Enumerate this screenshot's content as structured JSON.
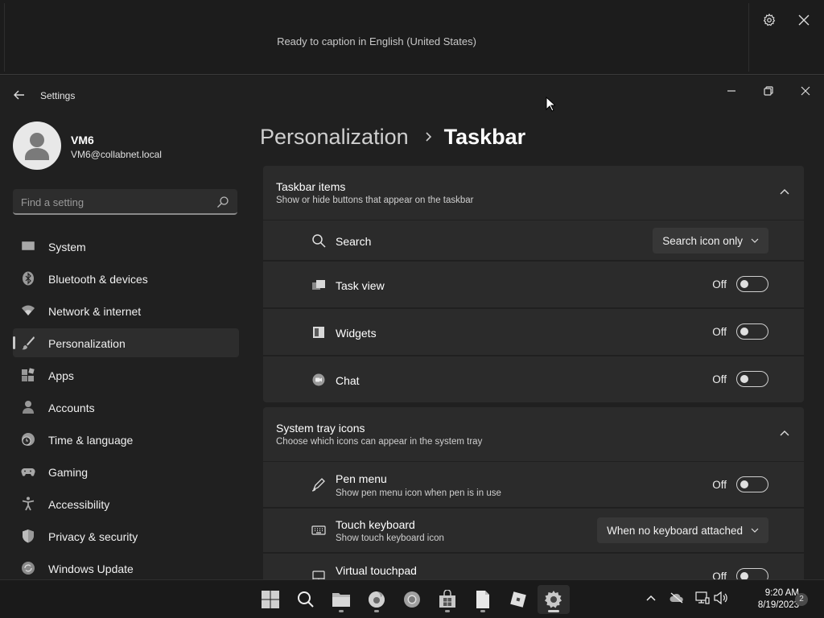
{
  "live_captions": {
    "status_text": "Ready to caption in English (United States)",
    "settings_icon": "gear-icon",
    "close_icon": "close-icon"
  },
  "window": {
    "app_title": "Settings",
    "back_icon": "back-arrow-icon",
    "minimize_icon": "minimize-icon",
    "restore_icon": "restore-icon",
    "close_icon": "close-icon"
  },
  "user": {
    "name": "VM6",
    "email": "VM6@collabnet.local"
  },
  "search": {
    "placeholder": "Find a setting",
    "value": ""
  },
  "sidebar": {
    "items": [
      {
        "label": "System",
        "icon": "monitor-icon",
        "active": false
      },
      {
        "label": "Bluetooth & devices",
        "icon": "bluetooth-icon",
        "active": false
      },
      {
        "label": "Network & internet",
        "icon": "wifi-icon",
        "active": false
      },
      {
        "label": "Personalization",
        "icon": "brush-icon",
        "active": true
      },
      {
        "label": "Apps",
        "icon": "apps-icon",
        "active": false
      },
      {
        "label": "Accounts",
        "icon": "person-icon",
        "active": false
      },
      {
        "label": "Time & language",
        "icon": "clock-globe-icon",
        "active": false
      },
      {
        "label": "Gaming",
        "icon": "gamepad-icon",
        "active": false
      },
      {
        "label": "Accessibility",
        "icon": "accessibility-icon",
        "active": false
      },
      {
        "label": "Privacy & security",
        "icon": "shield-icon",
        "active": false
      },
      {
        "label": "Windows Update",
        "icon": "update-icon",
        "active": false
      }
    ]
  },
  "breadcrumb": {
    "parent": "Personalization",
    "current": "Taskbar"
  },
  "taskbar_items": {
    "title": "Taskbar items",
    "subtitle": "Show or hide buttons that appear on the taskbar",
    "rows": [
      {
        "label": "Search",
        "icon": "search-icon",
        "dropdown_value": "Search icon only"
      },
      {
        "label": "Task view",
        "icon": "task-view-icon",
        "state": "Off"
      },
      {
        "label": "Widgets",
        "icon": "widgets-icon",
        "state": "Off"
      },
      {
        "label": "Chat",
        "icon": "chat-icon",
        "state": "Off"
      }
    ]
  },
  "system_tray": {
    "title": "System tray icons",
    "subtitle": "Choose which icons can appear in the system tray",
    "rows": [
      {
        "label": "Pen menu",
        "sub": "Show pen menu icon when pen is in use",
        "icon": "pen-icon",
        "state": "Off"
      },
      {
        "label": "Touch keyboard",
        "sub": "Show touch keyboard icon",
        "icon": "keyboard-icon",
        "dropdown_value": "When no keyboard attached"
      },
      {
        "label": "Virtual touchpad",
        "icon": "touchpad-icon",
        "state": "Off"
      }
    ]
  },
  "os_taskbar": {
    "apps": [
      "start-icon",
      "search-icon",
      "file-explorer-icon",
      "firefox-icon",
      "chrome-icon",
      "store-icon",
      "notepad-icon",
      "roblox-icon",
      "settings-icon"
    ],
    "time": "9:20 AM",
    "date": "8/19/2023",
    "notification_count": "2"
  },
  "colors": {
    "window_bg": "#202020",
    "card_bg": "#2b2b2b",
    "taskbar_bg": "#1a1a1a"
  }
}
